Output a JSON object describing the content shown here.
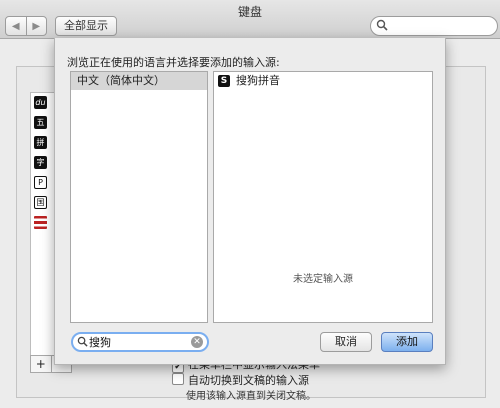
{
  "window": {
    "title": "键盘"
  },
  "toolbar": {
    "back_glyph": "◀",
    "forward_glyph": "▶",
    "show_all_label": "全部显示",
    "search_placeholder": ""
  },
  "background": {
    "source_icons": [
      {
        "name": "du-icon",
        "glyph": "du"
      },
      {
        "name": "wubi-icon",
        "glyph": "五"
      },
      {
        "name": "pinyin-icon",
        "glyph": "拼"
      },
      {
        "name": "char-icon",
        "glyph": "字"
      },
      {
        "name": "p-icon",
        "glyph": "P"
      },
      {
        "name": "guo-icon",
        "glyph": "国"
      },
      {
        "name": "us-flag-icon",
        "glyph": ""
      }
    ],
    "add_glyph": "+",
    "remove_glyph": "−",
    "show_menu_checkbox": {
      "label": "在菜单栏中显示输入法菜单",
      "checked": true
    },
    "auto_switch_checkbox": {
      "label": "自动切换到文稿的输入源",
      "checked": false
    },
    "note": "使用该输入源直到关闭文稿。"
  },
  "sheet": {
    "prompt": "浏览正在使用的语言并选择要添加的输入源:",
    "languages": [
      {
        "label": "中文（简体中文）",
        "selected": true
      }
    ],
    "sources": [
      {
        "icon": "S",
        "label": "搜狗拼音"
      }
    ],
    "none_selected": "未选定输入源",
    "search_value": "搜狗",
    "cancel_label": "取消",
    "add_label": "添加"
  },
  "colors": {
    "accent": "#7db0ee",
    "selection": "#d6d6d6"
  }
}
